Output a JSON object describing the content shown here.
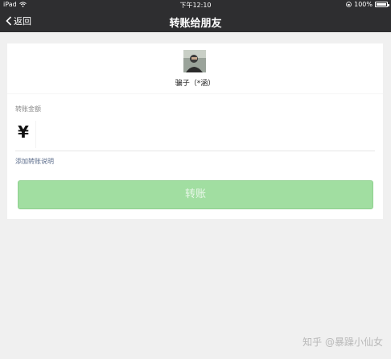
{
  "status_bar": {
    "device": "iPad",
    "time": "下午12:10",
    "battery": "100%"
  },
  "nav": {
    "back_label": "返回",
    "title": "转账给朋友"
  },
  "recipient": {
    "name": "骗子（*涵）"
  },
  "amount": {
    "label": "转账金额",
    "currency_symbol": "¥",
    "value": ""
  },
  "add_note": "添加转账说明",
  "transfer_button": {
    "label": "转账",
    "state": "disabled",
    "color": "#a1dea1"
  },
  "watermark": "知乎 @暴躁小仙女",
  "colors": {
    "bar_bg": "#2e2e30",
    "page_bg": "#f0f0f0",
    "link": "#5a6b8a"
  }
}
